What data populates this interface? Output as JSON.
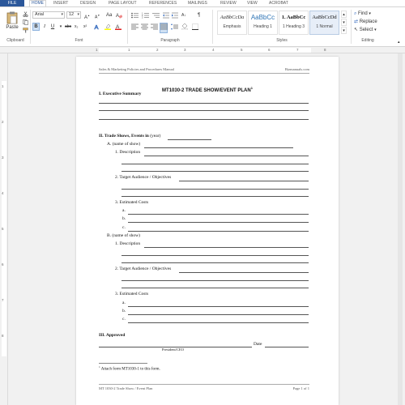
{
  "tabs": {
    "file": "FILE",
    "items": [
      "HOME",
      "INSERT",
      "DESIGN",
      "PAGE LAYOUT",
      "REFERENCES",
      "MAILINGS",
      "REVIEW",
      "VIEW",
      "ACROBAT"
    ],
    "active": "HOME"
  },
  "ribbon": {
    "clipboard": {
      "paste": "Paste",
      "label": "Clipboard"
    },
    "font": {
      "name": "Arial",
      "size": "12",
      "label": "Font",
      "aa": "Aa",
      "bold": "B",
      "italic": "I",
      "underline": "U"
    },
    "paragraph": {
      "label": "Paragraph",
      "pilcrow": "¶"
    },
    "styles": {
      "label": "Styles",
      "items": [
        {
          "sample": "AaBbCcDa",
          "name": "Emphasis"
        },
        {
          "sample": "AaBbCc",
          "name": "Heading 1"
        },
        {
          "sample": "1. AaBbCc",
          "name": "1 Heading 3"
        },
        {
          "sample": "AaBbCcDd",
          "name": "1 Normal"
        }
      ]
    },
    "editing": {
      "find": "Find",
      "replace": "Replace",
      "select": "Select",
      "label": "Editing"
    }
  },
  "ruler": {
    "h": [
      "1",
      "1",
      "2",
      "3",
      "4",
      "5",
      "6",
      "7",
      "8"
    ],
    "v": [
      "1",
      "2",
      "3",
      "4",
      "5",
      "6",
      "7",
      "8"
    ]
  },
  "document": {
    "header_left": "Sales & Marketing Policies and Procedures Manual",
    "header_right": "Bizmanuals.com",
    "title": "MT1030-2 TRADE SHOW/EVENT PLAN",
    "title_sup": "1",
    "section1": "I. Executive Summary",
    "section2": "II. Trade Shows, Events in",
    "section2_suffix": "(year)",
    "a_label": "A. (name of show)",
    "b_label": "B. (name of show)",
    "desc": "1. Description",
    "target": "2. Target Audience / Objectives",
    "costs": "3. Estimated Costs",
    "cost_a": "a.",
    "cost_b": "b.",
    "cost_c": "c.",
    "section3": "III. Approved",
    "date": "Date",
    "president": "President/CEO",
    "footnote_num": "1",
    "footnote": "Attach form MT1030-1 to this form.",
    "footer_left": "MT 1030-2 Trade Show / Event Plan",
    "footer_right": "Page 1 of 1"
  }
}
